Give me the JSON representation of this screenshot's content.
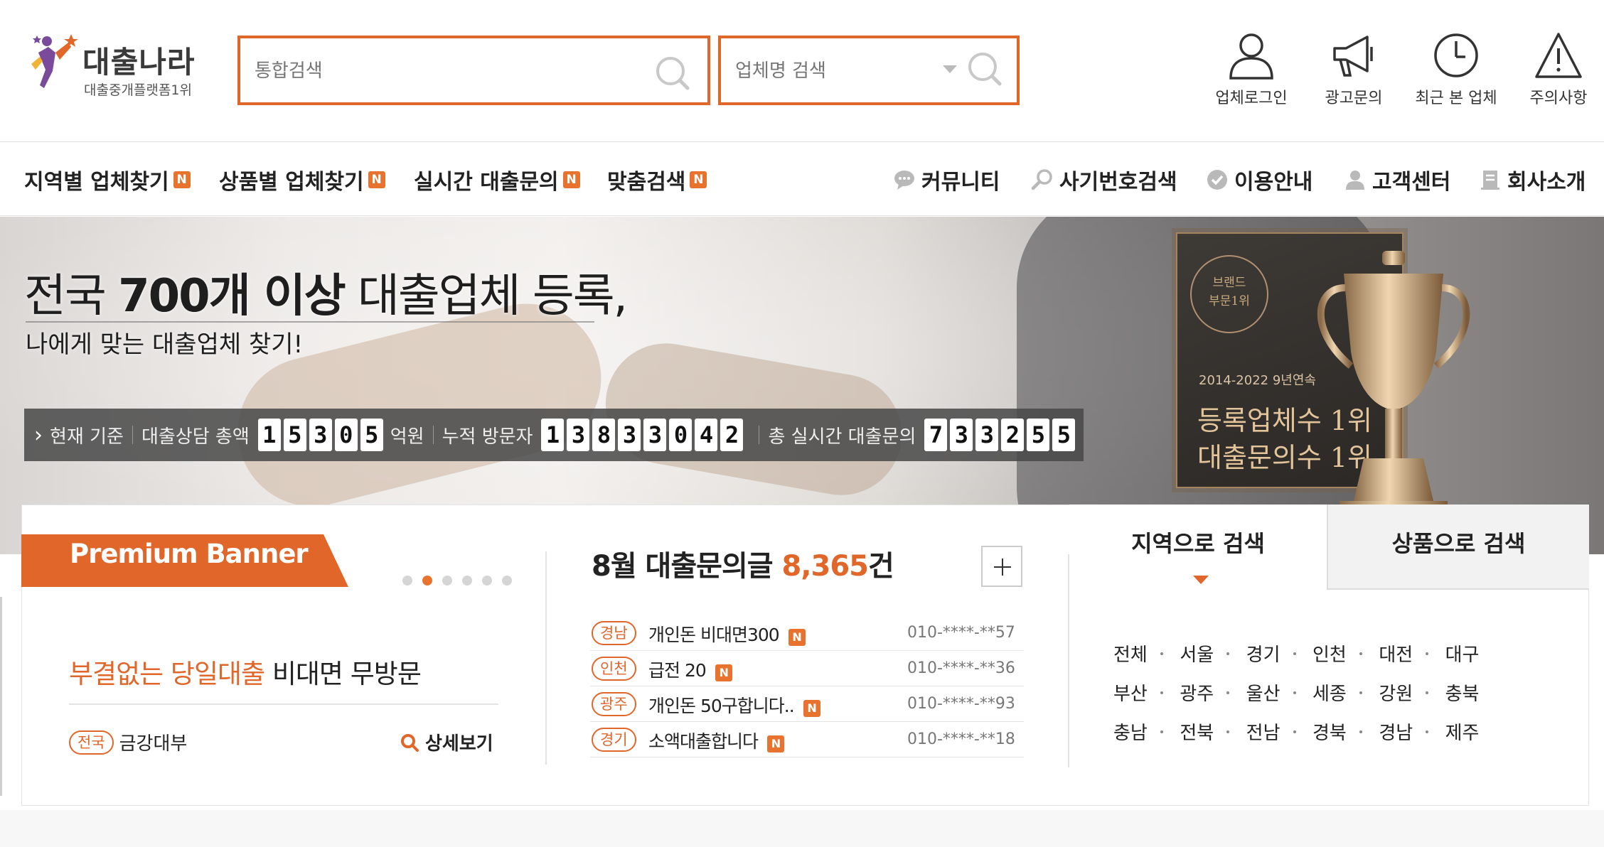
{
  "logo": {
    "title": "대출나라",
    "subtitle": "대출중개플랫폼1위"
  },
  "search": {
    "main_placeholder": "통합검색",
    "company_placeholder": "업체명 검색"
  },
  "utilities": [
    {
      "label": "업체로그인",
      "icon": "user-icon"
    },
    {
      "label": "광고문의",
      "icon": "megaphone-icon"
    },
    {
      "label": "최근 본 업체",
      "icon": "clock-icon"
    },
    {
      "label": "주의사항",
      "icon": "warning-icon"
    }
  ],
  "nav": {
    "left": [
      {
        "label": "지역별 업체찾기",
        "badge": "N"
      },
      {
        "label": "상품별 업체찾기",
        "badge": "N"
      },
      {
        "label": "실시간 대출문의",
        "badge": "N"
      },
      {
        "label": "맞춤검색",
        "badge": "N"
      }
    ],
    "right": [
      {
        "label": "커뮤니티",
        "icon": "chat-bubble-icon"
      },
      {
        "label": "사기번호검색",
        "icon": "magnifier-icon"
      },
      {
        "label": "이용안내",
        "icon": "check-circle-icon"
      },
      {
        "label": "고객센터",
        "icon": "person-icon"
      },
      {
        "label": "회사소개",
        "icon": "document-icon"
      }
    ]
  },
  "hero": {
    "title_pre": "전국 ",
    "title_bold": "700개 이상",
    "title_post": " 대출업체 등록,",
    "subtitle": "나에게 맞는 대출업체 찾기!",
    "stats": {
      "current": "현재 기준",
      "total_label": "대출상담 총액",
      "total_digits": [
        "1",
        "5",
        "3",
        "0",
        "5"
      ],
      "total_unit": "억원",
      "visitors_label": "누적 방문자",
      "visitors_digits": [
        "1",
        "3",
        "8",
        "3",
        "3",
        "0",
        "4",
        "2"
      ],
      "inquiries_label": "총 실시간 대출문의",
      "inquiries_digits": [
        "7",
        "3",
        "3",
        "2",
        "5",
        "5"
      ]
    },
    "award": {
      "seal": "브랜드\n부문1위",
      "period": "2014-2022 9년연속",
      "line1": "등록업체수 1위",
      "line2": "대출문의수 1위"
    }
  },
  "premium": {
    "label": "Premium Banner",
    "promo_highlight": "부결없는 당일대출",
    "promo_rest": " 비대면 무방문",
    "region": "전국",
    "company": "금강대부",
    "detail_label": "상세보기"
  },
  "inquiries": {
    "title_pre": "8월 대출문의글 ",
    "count": "8,365",
    "title_post": "건",
    "items": [
      {
        "region": "경남",
        "text": "개인돈 비대면300",
        "badge": "N",
        "phone": "010-****-**57"
      },
      {
        "region": "인천",
        "text": "급전 20",
        "badge": "N",
        "phone": "010-****-**36"
      },
      {
        "region": "광주",
        "text": "개인돈 50구합니다..",
        "badge": "N",
        "phone": "010-****-**93"
      },
      {
        "region": "경기",
        "text": "소액대출합니다",
        "badge": "N",
        "phone": "010-****-**18"
      },
      {
        "region": "",
        "text": "",
        "badge": "",
        "phone": ""
      }
    ]
  },
  "search_tabs": {
    "region_tab": "지역으로 검색",
    "product_tab": "상품으로 검색",
    "regions": [
      [
        "전체",
        "서울",
        "경기",
        "인천",
        "대전",
        "대구"
      ],
      [
        "부산",
        "광주",
        "울산",
        "세종",
        "강원",
        "충북"
      ],
      [
        "충남",
        "전북",
        "전남",
        "경북",
        "경남",
        "제주"
      ]
    ]
  },
  "colors": {
    "accent": "#e0662a",
    "badge": "#e8732f",
    "dark_text": "#222222"
  }
}
